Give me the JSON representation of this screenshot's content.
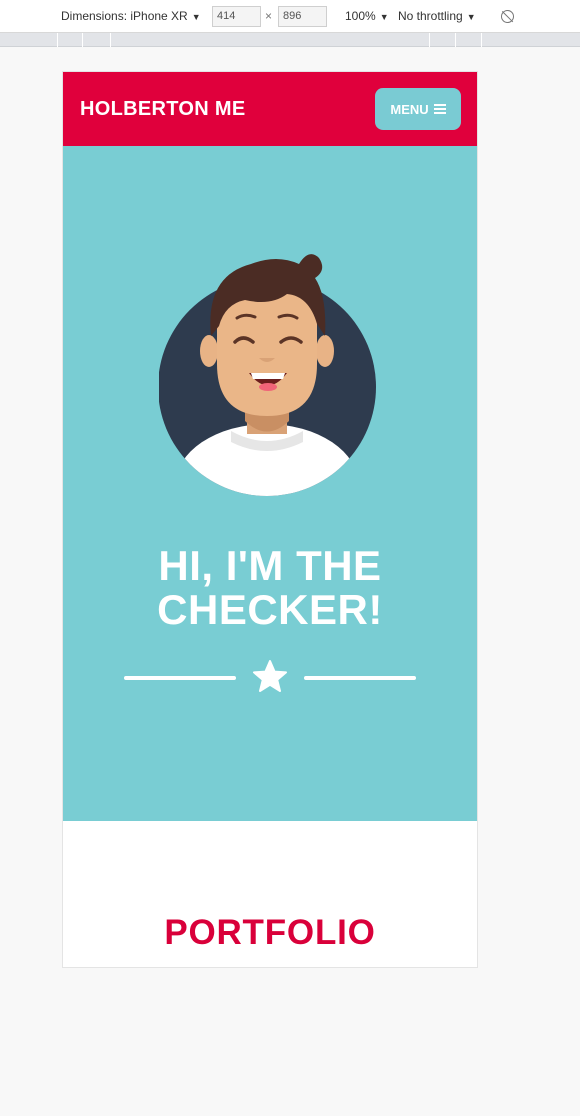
{
  "devtools": {
    "device": "Dimensions: iPhone XR",
    "width": "414",
    "height": "896",
    "times": "×",
    "zoom": "100%",
    "throttling": "No throttling",
    "rotate_icon": "rotate-icon"
  },
  "navbar": {
    "brand": "HOLBERTON ME",
    "menu_label": "MENU",
    "menu_icon": "hamburger-icon",
    "color": "#e0003c"
  },
  "hero": {
    "title": "HI, I'M THE CHECKER!",
    "avatar_icon": "avatar",
    "divider_icon": "star-icon",
    "color": "#79cdd3"
  },
  "portfolio": {
    "title": "PORTFOLIO",
    "color": "#d9003a"
  }
}
